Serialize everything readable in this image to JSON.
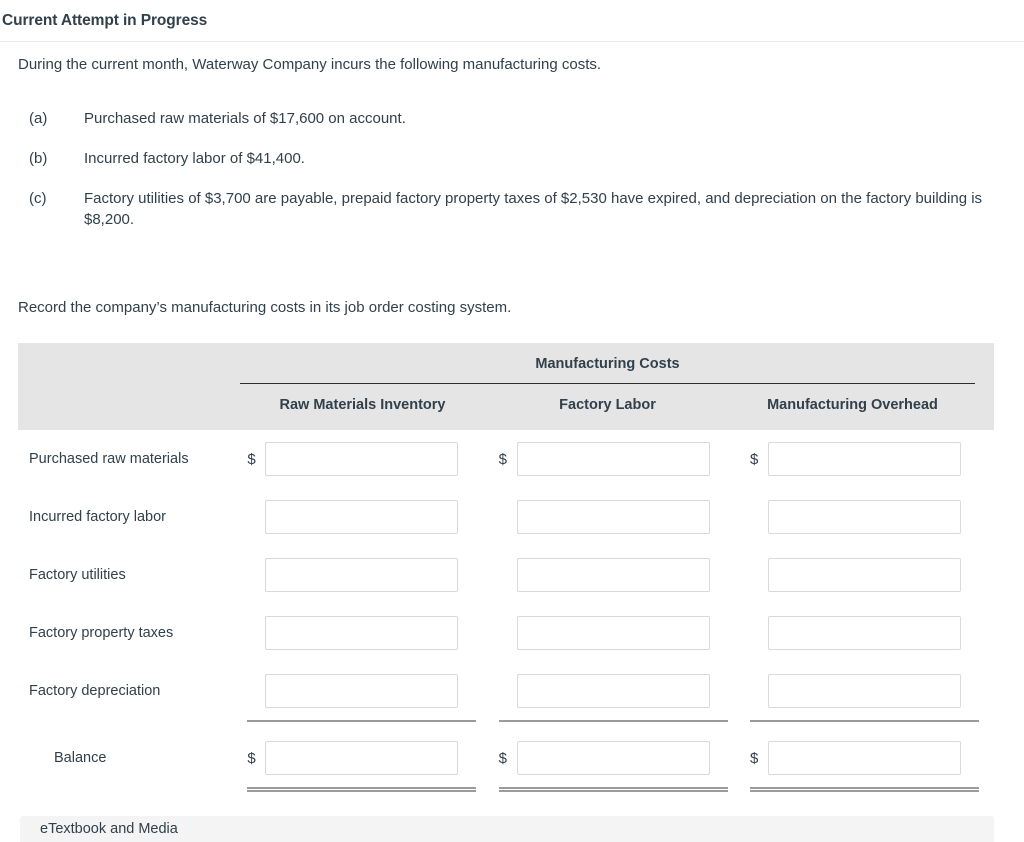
{
  "header": {
    "title": "Current Attempt in Progress"
  },
  "intro": "During the current month, Waterway Company incurs the following manufacturing costs.",
  "items": [
    {
      "marker": "(a)",
      "text": "Purchased raw materials of $17,600 on account."
    },
    {
      "marker": "(b)",
      "text": "Incurred factory labor of $41,400."
    },
    {
      "marker": "(c)",
      "text": "Factory utilities of $3,700 are payable, prepaid factory property taxes of $2,530 have expired, and depreciation on the factory building is $8,200."
    }
  ],
  "record_line": "Record the company’s manufacturing costs in its job order costing system.",
  "table": {
    "group_title": "Manufacturing Costs",
    "columns": [
      "Raw Materials Inventory",
      "Factory Labor",
      "Manufacturing Overhead"
    ],
    "currency_symbol": "$",
    "rows": [
      {
        "label": "Purchased raw materials",
        "show_dollar": true,
        "values": [
          "",
          "",
          ""
        ]
      },
      {
        "label": "Incurred factory labor",
        "show_dollar": false,
        "values": [
          "",
          "",
          ""
        ]
      },
      {
        "label": "Factory utilities",
        "show_dollar": false,
        "values": [
          "",
          "",
          ""
        ]
      },
      {
        "label": "Factory property taxes",
        "show_dollar": false,
        "values": [
          "",
          "",
          ""
        ]
      },
      {
        "label": "Factory depreciation",
        "show_dollar": false,
        "values": [
          "",
          "",
          ""
        ]
      }
    ],
    "balance_row": {
      "label": "Balance",
      "show_dollar": true,
      "values": [
        "",
        "",
        ""
      ]
    },
    "input_placeholder": ""
  },
  "footer": {
    "etextbook_label": "eTextbook and Media"
  },
  "colors": {
    "text": "#31404b",
    "header_bg": "#e5e5e5",
    "footer_bg": "#f4f4f4",
    "input_border": "#d9d9d9",
    "rule": "#9b9b9b"
  }
}
